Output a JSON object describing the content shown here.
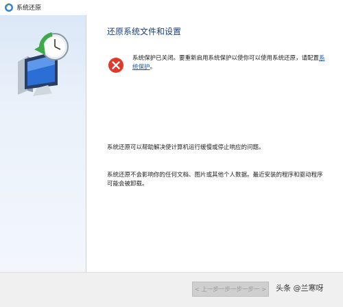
{
  "window": {
    "title": "系统还原",
    "icon": "system-restore-icon"
  },
  "main": {
    "heading": "还原系统文件和设置",
    "error": {
      "icon": "error-icon",
      "color": "#e0392b",
      "text_before": "系统保护已关闭。要重新启用系统保护以使你可以使用系统还原，请配置",
      "link": "系统保护",
      "text_after": "。"
    },
    "paragraph1": "系统还原可以帮助解决使计算机运行缓慢或停止响应的问题。",
    "paragraph2": "系统还原不会影响你的任何文档、图片或其他个人数据。最近安装的程序和驱动程序可能会被卸载。"
  },
  "footer": {
    "back_label": "< 上一步一步一步一步一 >",
    "watermark": "头条 @兰寒呀"
  },
  "colors": {
    "heading": "#1b3f74",
    "link": "#1a58b4",
    "sidebar_top": "#dbe8f7"
  }
}
